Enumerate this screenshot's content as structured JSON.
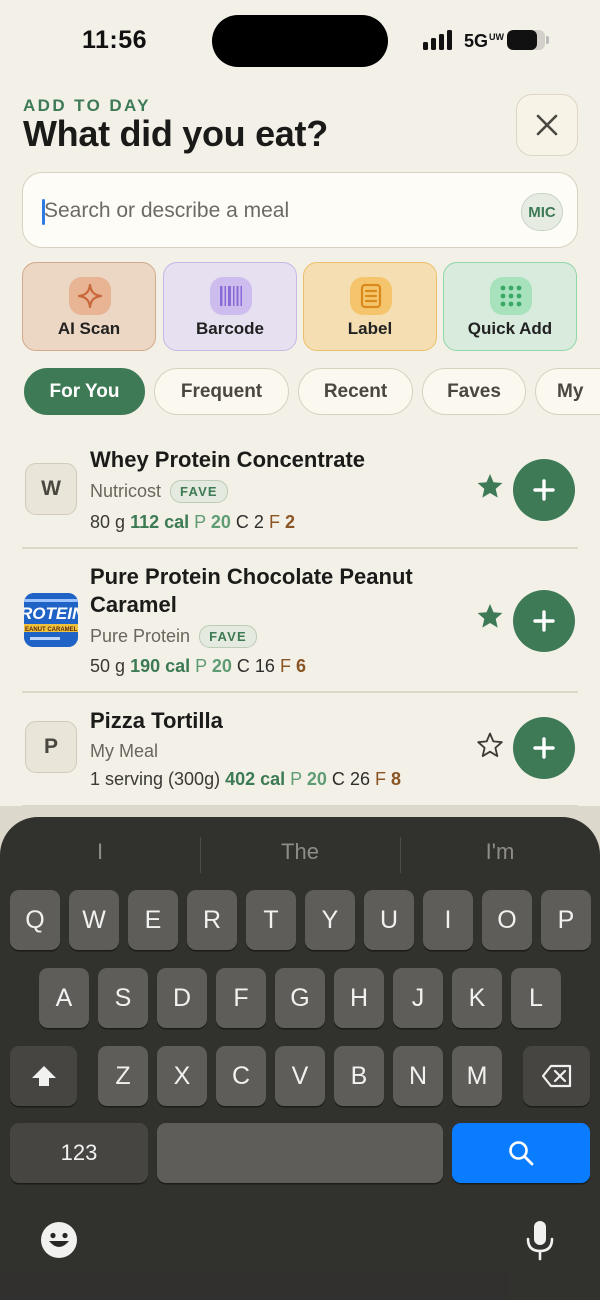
{
  "status_bar": {
    "time": "11:56",
    "network": "5G",
    "network_sup": "UW",
    "battery_level": 0.78
  },
  "header": {
    "kicker": "ADD TO DAY",
    "title": "What did you eat?"
  },
  "search": {
    "placeholder": "Search or describe a meal",
    "mic_label": "MIC"
  },
  "actions": [
    {
      "label": "AI Scan",
      "icon": "sparkle-icon",
      "color": "#c7693a"
    },
    {
      "label": "Barcode",
      "icon": "barcode-icon",
      "color": "#8a6ad6"
    },
    {
      "label": "Label",
      "icon": "label-icon",
      "color": "#d98a1a"
    },
    {
      "label": "Quick Add",
      "icon": "grid-dots-icon",
      "color": "#3aa866"
    }
  ],
  "filters": [
    "For You",
    "Frequent",
    "Recent",
    "Faves",
    "My"
  ],
  "filter_active": "For You",
  "foods": [
    {
      "avatar": "W",
      "name": "Whey Protein Concentrate",
      "brand": "Nutricost",
      "badge": "FAVE",
      "serving": "80 g",
      "cal": "112 cal",
      "p_label": "P",
      "p": "20",
      "c_label": "C",
      "c": "2",
      "f_label": "F",
      "f": "2",
      "starred": true
    },
    {
      "avatar_image": "ROTEIN",
      "avatar_image_sub": "EANUT CARAMEL",
      "name": "Pure Protein Chocolate Peanut Caramel",
      "brand": "Pure Protein",
      "badge": "FAVE",
      "serving": "50 g",
      "cal": "190 cal",
      "p_label": "P",
      "p": "20",
      "c_label": "C",
      "c": "16",
      "f_label": "F",
      "f": "6",
      "starred": true
    },
    {
      "avatar": "P",
      "name": "Pizza Tortilla",
      "brand": "My Meal",
      "serving": "1 serving (300g)",
      "cal": "402 cal",
      "p_label": "P",
      "p": "20",
      "c_label": "C",
      "c": "26",
      "f_label": "F",
      "f": "8",
      "starred": false
    }
  ],
  "keyboard": {
    "suggestions": [
      "I",
      "The",
      "I'm"
    ],
    "row1": [
      "Q",
      "W",
      "E",
      "R",
      "T",
      "Y",
      "U",
      "I",
      "O",
      "P"
    ],
    "row2": [
      "A",
      "S",
      "D",
      "F",
      "G",
      "H",
      "J",
      "K",
      "L"
    ],
    "row3": [
      "Z",
      "X",
      "C",
      "V",
      "B",
      "N",
      "M"
    ],
    "numbers_label": "123"
  }
}
